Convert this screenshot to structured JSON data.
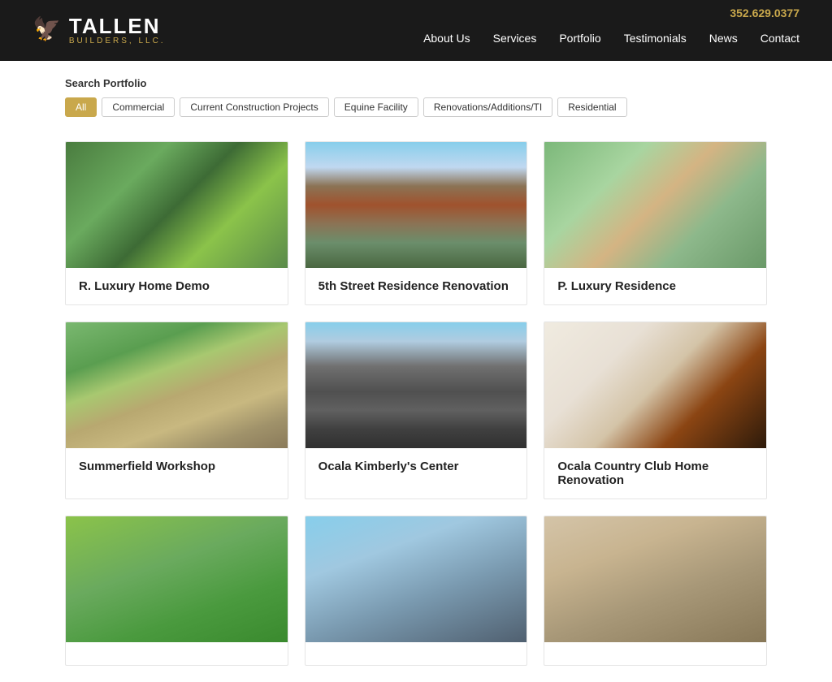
{
  "header": {
    "phone": "352.629.0377",
    "logo_main": "TALLEN",
    "logo_sub": "BUILDERS, LLC.",
    "nav_items": [
      {
        "label": "About Us",
        "href": "#"
      },
      {
        "label": "Services",
        "href": "#"
      },
      {
        "label": "Portfolio",
        "href": "#"
      },
      {
        "label": "Testimonials",
        "href": "#"
      },
      {
        "label": "News",
        "href": "#"
      },
      {
        "label": "Contact",
        "href": "#"
      }
    ]
  },
  "portfolio": {
    "search_label": "Search Portfolio",
    "filters": [
      {
        "label": "All",
        "active": true
      },
      {
        "label": "Commercial",
        "active": false
      },
      {
        "label": "Current Construction Projects",
        "active": false
      },
      {
        "label": "Equine Facility",
        "active": false
      },
      {
        "label": "Renovations/Additions/TI",
        "active": false
      },
      {
        "label": "Residential",
        "active": false
      }
    ],
    "projects": [
      {
        "title": "R. Luxury Home Demo",
        "img_class": "img-aerial-1"
      },
      {
        "title": "5th Street Residence Renovation",
        "img_class": "img-brick-house"
      },
      {
        "title": "P. Luxury Residence",
        "img_class": "img-aerial-2"
      },
      {
        "title": "Summerfield Workshop",
        "img_class": "img-workshop"
      },
      {
        "title": "Ocala Kimberly's Center",
        "img_class": "img-center"
      },
      {
        "title": "Ocala Country Club Home Renovation",
        "img_class": "img-interior"
      },
      {
        "title": "",
        "img_class": "img-partial-1"
      },
      {
        "title": "",
        "img_class": "img-partial-2"
      },
      {
        "title": "",
        "img_class": "img-partial-3"
      }
    ]
  }
}
